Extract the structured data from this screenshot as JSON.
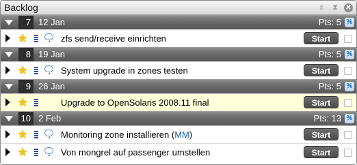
{
  "window": {
    "title": "Backlog"
  },
  "icons": {
    "sort": "sort-updown-icon",
    "collapse": "collapse-icon",
    "close": "close-icon"
  },
  "groups": [
    {
      "number": "7",
      "date": "12 Jan",
      "points": "Pts: 5",
      "percent_label": "%",
      "items": [
        {
          "text": "zfs send/receive einrichten",
          "has_comment": true,
          "action": "Start"
        }
      ]
    },
    {
      "number": "8",
      "date": "19 Jan",
      "points": "Pts: 5",
      "percent_label": "%",
      "items": [
        {
          "text": "System upgrade in zones testen",
          "has_comment": true,
          "action": "Start"
        }
      ]
    },
    {
      "number": "9",
      "date": "26 Jan",
      "points": "Pts: 5",
      "percent_label": "%",
      "items": [
        {
          "text": "Upgrade to OpenSolaris 2008.11 final",
          "has_comment": false,
          "action": "Start",
          "highlighted": true
        }
      ]
    },
    {
      "number": "10",
      "date": "2 Feb",
      "points": "Pts: 13",
      "percent_label": "%",
      "items": [
        {
          "text": "Monitoring zone installieren (",
          "link": "MM",
          "suffix": ")",
          "has_comment": true,
          "action": "Start"
        },
        {
          "text": "Von mongrel auf passenger umstellen",
          "has_comment": true,
          "action": "Start"
        }
      ]
    }
  ],
  "colors": {
    "star": "#f0c419",
    "active_row": "#ffffd9",
    "link": "#1557b8",
    "group_bar": "#6a6a6a"
  }
}
